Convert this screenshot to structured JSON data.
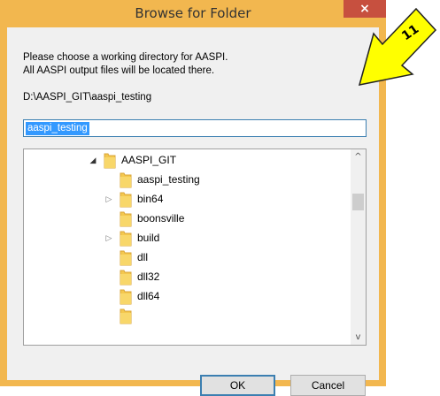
{
  "window": {
    "title": "Browse for Folder",
    "close_glyph": "×"
  },
  "message": {
    "line1": "Please choose a working directory for AASPI.",
    "line2": "All AASPI output files will be located there."
  },
  "current_path": "D:\\AASPI_GIT\\aaspi_testing",
  "folder_name_value": "aaspi_testing",
  "tree": {
    "items": [
      {
        "label": "AASPI_GIT",
        "expander": "◢",
        "level": 0
      },
      {
        "label": "aaspi_testing",
        "expander": "",
        "level": 1
      },
      {
        "label": "bin64",
        "expander": "▷",
        "level": 1
      },
      {
        "label": "boonsville",
        "expander": "",
        "level": 1
      },
      {
        "label": "build",
        "expander": "▷",
        "level": 1
      },
      {
        "label": "dll",
        "expander": "",
        "level": 1
      },
      {
        "label": "dll32",
        "expander": "",
        "level": 1
      },
      {
        "label": "dll64",
        "expander": "",
        "level": 1
      }
    ]
  },
  "scrollbar": {
    "up_glyph": "^",
    "down_glyph": "v"
  },
  "buttons": {
    "ok_label": "OK",
    "cancel_label": "Cancel"
  },
  "callout": {
    "label": "11",
    "color": "#ffff00"
  }
}
